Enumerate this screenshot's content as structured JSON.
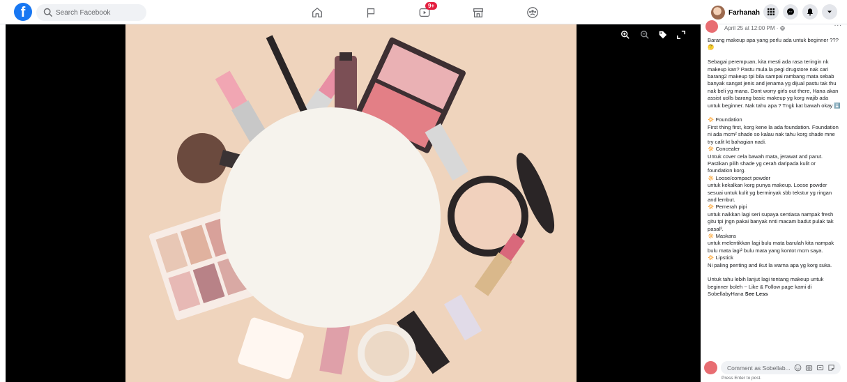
{
  "header": {
    "logo_letter": "f",
    "search_placeholder": "Search Facebook",
    "watch_badge": "9+",
    "profile_name": "Farhanah"
  },
  "post": {
    "time": "April 25 at 12:00 PM · ",
    "more": "...",
    "body": "Barang makeup apa yang perlu ada untuk beginner ??? 🤔\n\nSebagai perempuan, kita mesti ada rasa teringin nk makeup kan? Pastu mula la pegi drugstore nak cari barang2 makeup tpi bila sampai rambang mata sebab banyak sangat jenis and jenama yg dijual pastu tak thu nak beli yg mana. Dont worry girls out there, Hana akan assist uolls barang basic makeup yg korg wajib ada untuk beginner. Nak tahu apa ? Tngk kat bawah okay ⬇️\n\n🔅 Foundation\nFirst thing first, korg kene la ada foundation. Foundation ni ada mcm² shade so kalau nak tahu korg shade mne try calit kt bahagian nadi.\n🔅 Concealer\nUntuk cover cela bawah mata, jerawat and parut. Pastikan pilih shade yg cerah daripada kulit or foundation korg.\n🔅 Loose/compact powder\nuntuk kekalkan korg punya makeup. Loose powder sesuai untuk kulit yg berminyak sbb tekstur yg ringan and lembut.\n🔅 Pemerah pipi\nuntuk naikkan lagi seri supaya sentiasa nampak fresh gitu tpi jngn pakai banyak nnti macam badut pulak tak pasal².\n🔅 Maskara\nuntuk melentikkan lagi bulu mata barulah kita nampak bulu mata lagi² bulu mata yang kontot mcm saya.\n🔅 Lipstick\nNi paling penting and ikut la warna apa yg korg suka.\n\nUntuk tahu lebih lanjut lagi tentang makeup untuk beginner boleh ~ Like & Follow page kami di SobellabyHana ",
    "see_less": "See Less"
  },
  "comment": {
    "placeholder": "Comment as Sobellab...",
    "hint": "Press Enter to post."
  },
  "icons": {
    "nav": [
      "home-icon",
      "pages-flag-icon",
      "watch-icon",
      "marketplace-icon",
      "groups-icon"
    ],
    "header_right": [
      "menu-grid-icon",
      "messenger-icon",
      "notifications-bell-icon",
      "account-dropdown-icon"
    ],
    "viewer_tools": [
      "zoom-in-icon",
      "zoom-out-icon",
      "tag-icon",
      "fullscreen-icon"
    ]
  },
  "colors": {
    "brand": "#1877f2",
    "badge": "#e41e3f",
    "photo_background": "#efd4bd"
  }
}
